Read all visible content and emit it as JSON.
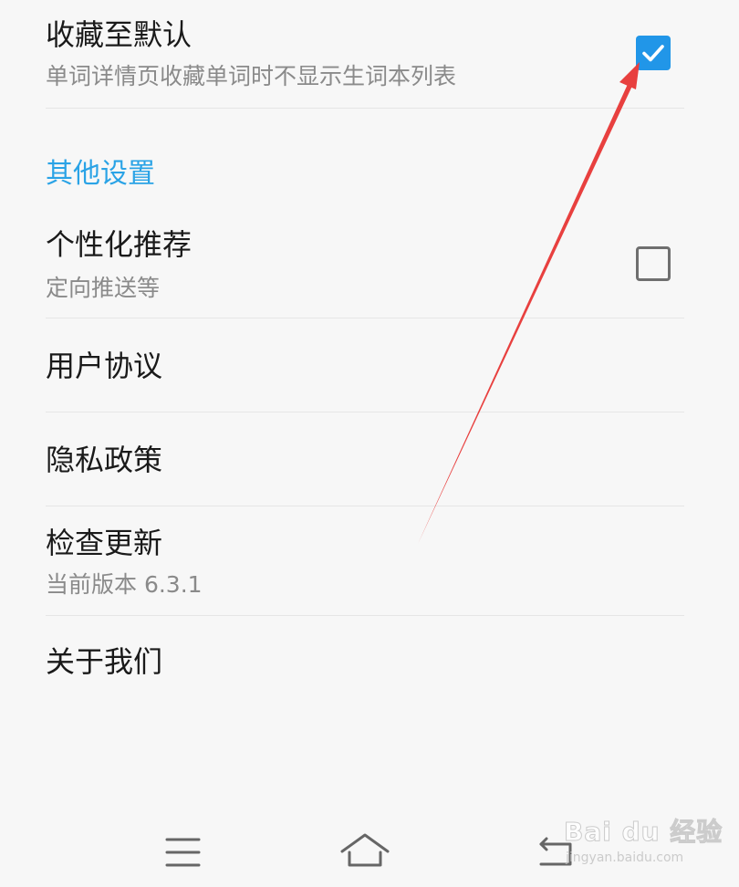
{
  "settings": {
    "favorite_default": {
      "title": "收藏至默认",
      "subtitle": "单词详情页收藏单词时不显示生词本列表",
      "checked": true
    },
    "section_other": "其他设置",
    "personalized": {
      "title": "个性化推荐",
      "subtitle": "定向推送等",
      "checked": false
    },
    "user_agreement": "用户协议",
    "privacy_policy": "隐私政策",
    "check_update": {
      "title": "检查更新",
      "subtitle": "当前版本 6.3.1"
    },
    "about_us": "关于我们"
  },
  "nav": {
    "menu_icon": "menu-icon",
    "home_icon": "home-icon",
    "back_icon": "back-icon"
  },
  "watermark": {
    "text": "Bai du 经验",
    "sub": "jingyan.baidu.com"
  },
  "colors": {
    "accent": "#2aa3e6",
    "checkbox_checked": "#2196e8",
    "annotation_arrow": "#e8403f",
    "background": "#f7f7f7"
  }
}
